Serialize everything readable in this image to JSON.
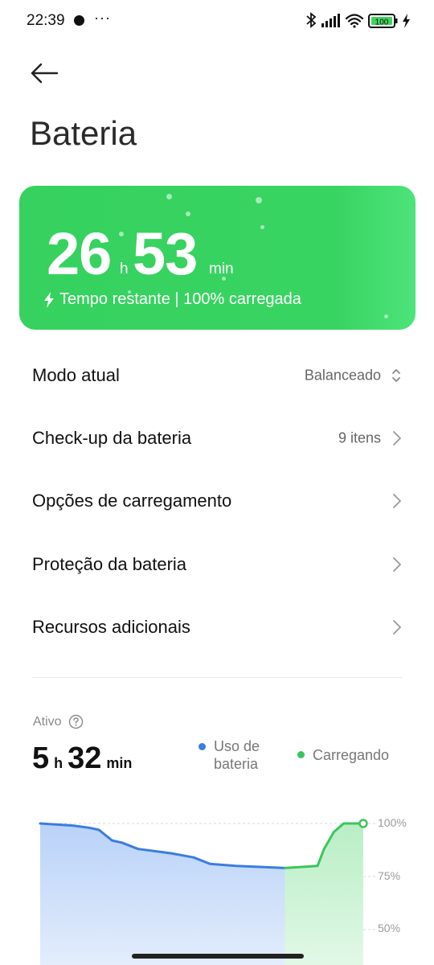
{
  "status_bar": {
    "time": "22:39",
    "more": "···",
    "battery_level": "100"
  },
  "page": {
    "title": "Bateria"
  },
  "battery_card": {
    "hours": "26",
    "hours_unit": "h",
    "minutes": "53",
    "minutes_unit": "min",
    "subtitle": "Tempo restante | 100% carregada"
  },
  "menu": [
    {
      "label": "Modo atual",
      "value": "Balanceado"
    },
    {
      "label": "Check-up da bateria",
      "value": "9 itens"
    },
    {
      "label": "Opções de carregamento",
      "value": ""
    },
    {
      "label": "Proteção da bateria",
      "value": ""
    },
    {
      "label": "Recursos adicionais",
      "value": ""
    }
  ],
  "usage": {
    "label": "Ativo",
    "hours": "5",
    "hours_unit": "h",
    "minutes": "32",
    "minutes_unit": "min",
    "legend": [
      {
        "label_line1": "Uso de",
        "label_line2": "bateria",
        "color": "#3b7de0"
      },
      {
        "label_line1": "Carregando",
        "label_line2": "",
        "color": "#3cc55e"
      }
    ]
  },
  "chart_data": {
    "type": "area",
    "y_ticks": [
      "100%",
      "75%",
      "50%"
    ],
    "ylim": [
      0,
      100
    ],
    "series": [
      {
        "name": "Uso de bateria",
        "color": "#3b7de0",
        "x": [
          0,
          10,
          15,
          18,
          22,
          25,
          30,
          40,
          47,
          52,
          60,
          75
        ],
        "values": [
          100,
          99,
          98,
          97,
          92,
          91,
          88,
          86,
          84,
          81,
          80,
          79
        ]
      },
      {
        "name": "Carregando",
        "color": "#3cc55e",
        "x": [
          75,
          85,
          87,
          90,
          93,
          95,
          99
        ],
        "values": [
          79,
          80,
          88,
          96,
          100,
          100,
          100
        ]
      }
    ]
  }
}
